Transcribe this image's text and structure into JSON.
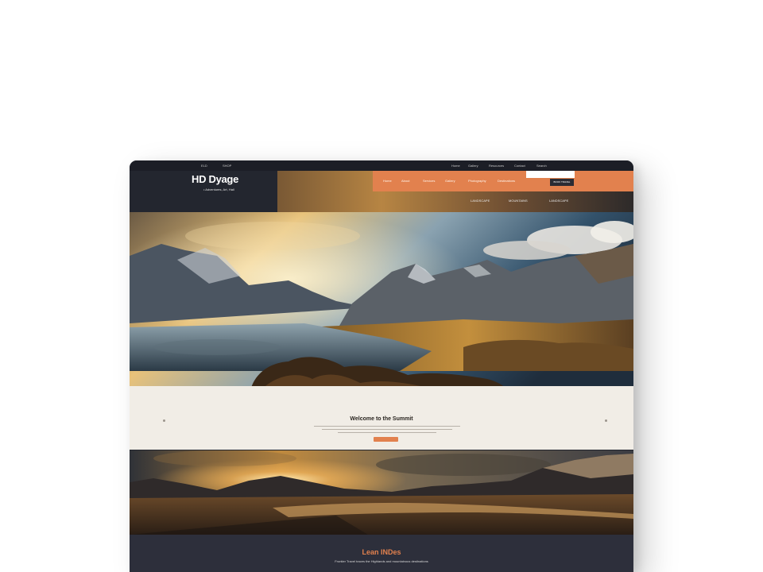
{
  "topbar": {
    "left_items": [
      "ELD",
      "SHOP"
    ],
    "right_items": [
      "Home",
      "Gallery",
      "Resources",
      "Contact",
      "Search"
    ]
  },
  "brand": {
    "title": "HD Dyage",
    "subtitle": "• Adventures, Art, Hail"
  },
  "nav": {
    "items": [
      "Home",
      "About",
      "Services",
      "Gallery",
      "Photography",
      "Destinations"
    ],
    "button_label": "BOOK TRAVEL",
    "sub_items": [
      "LANDSCAPE",
      "MOUNTAINS",
      "LANDSCAPE"
    ]
  },
  "welcome": {
    "title": "Welcome to the Summit"
  },
  "footer": {
    "title": "Lean INDes",
    "subtitle": "Frontier Travel traces the Highlands and mountainous destinations"
  },
  "colors": {
    "accent": "#e2814e",
    "dark": "#23262f",
    "cream": "#f1ede6"
  }
}
